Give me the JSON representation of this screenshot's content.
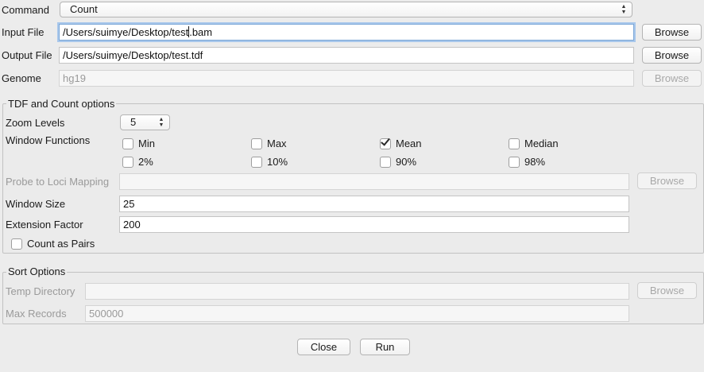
{
  "command": {
    "label": "Command",
    "value": "Count"
  },
  "input_file": {
    "label": "Input File",
    "value_before_caret": "/Users/suimye/Desktop/test",
    "value_after_caret": ".bam",
    "browse": "Browse"
  },
  "output_file": {
    "label": "Output File",
    "value": "/Users/suimye/Desktop/test.tdf",
    "browse": "Browse"
  },
  "genome": {
    "label": "Genome",
    "value": "hg19",
    "browse": "Browse"
  },
  "tdf_options": {
    "title": "TDF and Count options",
    "zoom_levels": {
      "label": "Zoom Levels",
      "value": "5"
    },
    "window_functions": {
      "label": "Window Functions",
      "options": [
        {
          "label": "Min",
          "checked": false
        },
        {
          "label": "Max",
          "checked": false
        },
        {
          "label": "Mean",
          "checked": true
        },
        {
          "label": "Median",
          "checked": false
        },
        {
          "label": "2%",
          "checked": false
        },
        {
          "label": "10%",
          "checked": false
        },
        {
          "label": "90%",
          "checked": false
        },
        {
          "label": "98%",
          "checked": false
        }
      ]
    },
    "probe_mapping": {
      "label": "Probe to Loci Mapping",
      "value": "",
      "browse": "Browse"
    },
    "window_size": {
      "label": "Window Size",
      "value": "25"
    },
    "extension_factor": {
      "label": "Extension Factor",
      "value": "200"
    },
    "count_as_pairs": {
      "label": "Count as Pairs",
      "checked": false
    }
  },
  "sort_options": {
    "title": "Sort Options",
    "temp_directory": {
      "label": "Temp Directory",
      "value": "",
      "browse": "Browse"
    },
    "max_records": {
      "label": "Max Records",
      "value": "500000"
    }
  },
  "actions": {
    "close": "Close",
    "run": "Run"
  }
}
